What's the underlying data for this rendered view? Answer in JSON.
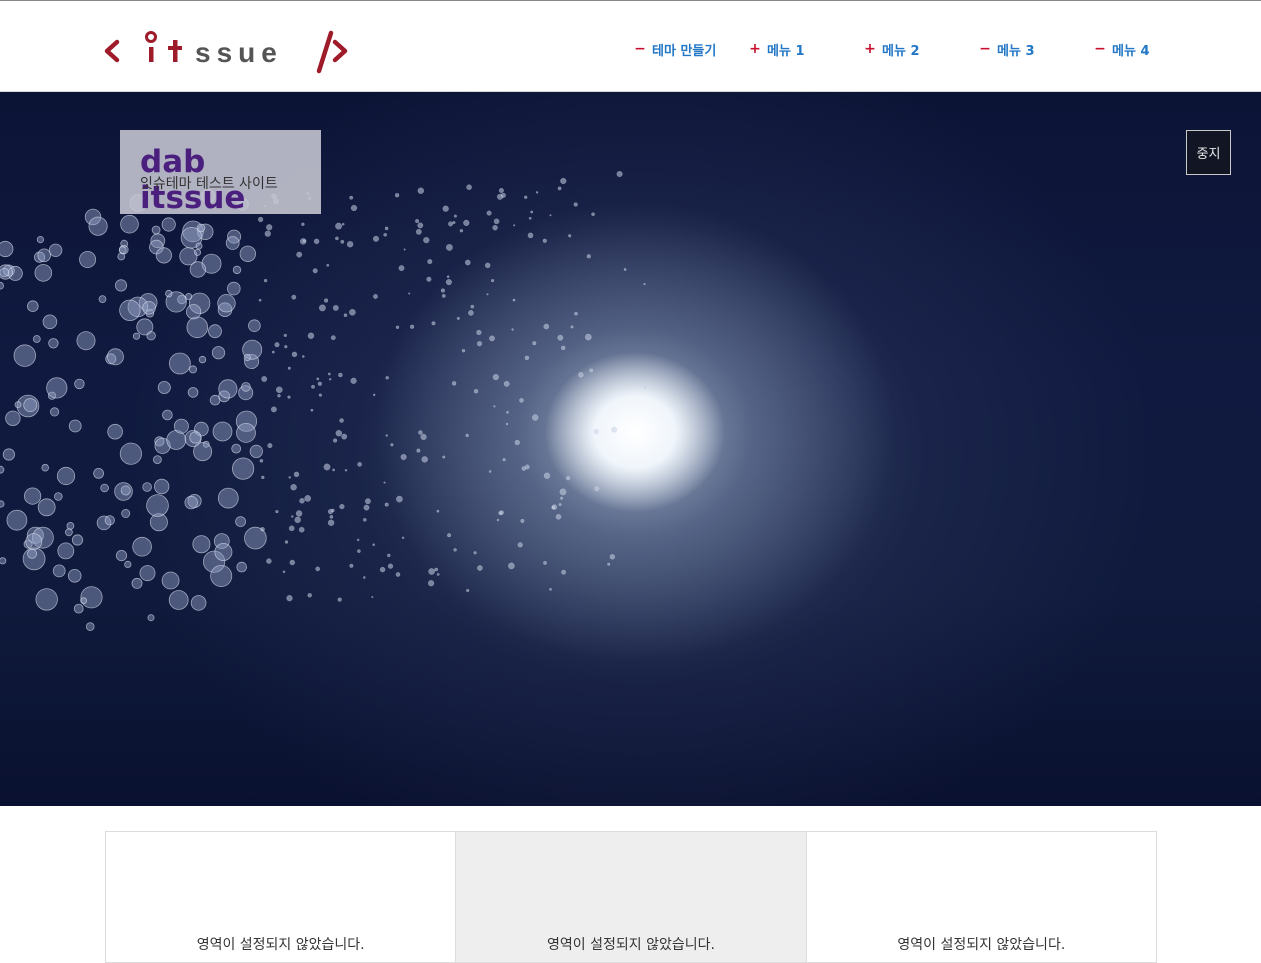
{
  "header": {
    "logo_text": "itssue",
    "nav": [
      {
        "symbol": "−",
        "label": "테마 만들기"
      },
      {
        "symbol": "+",
        "label": "메뉴 1"
      },
      {
        "symbol": "+",
        "label": "메뉴 2"
      },
      {
        "symbol": "−",
        "label": "메뉴 3"
      },
      {
        "symbol": "−",
        "label": "메뉴 4"
      }
    ]
  },
  "hero": {
    "title": "dab itssue",
    "subtitle": "잇슈테마 테스트 사이트",
    "stop_label": "중지"
  },
  "panels": [
    {
      "text": "영역이 설정되지 않았습니다."
    },
    {
      "text": "영역이 설정되지 않았습니다."
    },
    {
      "text": "영역이 설정되지 않았습니다."
    }
  ],
  "colors": {
    "brand_red": "#9e1b2a",
    "logo_gray": "#555555",
    "nav_blue": "#2377c7",
    "nav_symbol_red": "#c8102e",
    "title_purple": "#4b1f7e"
  }
}
